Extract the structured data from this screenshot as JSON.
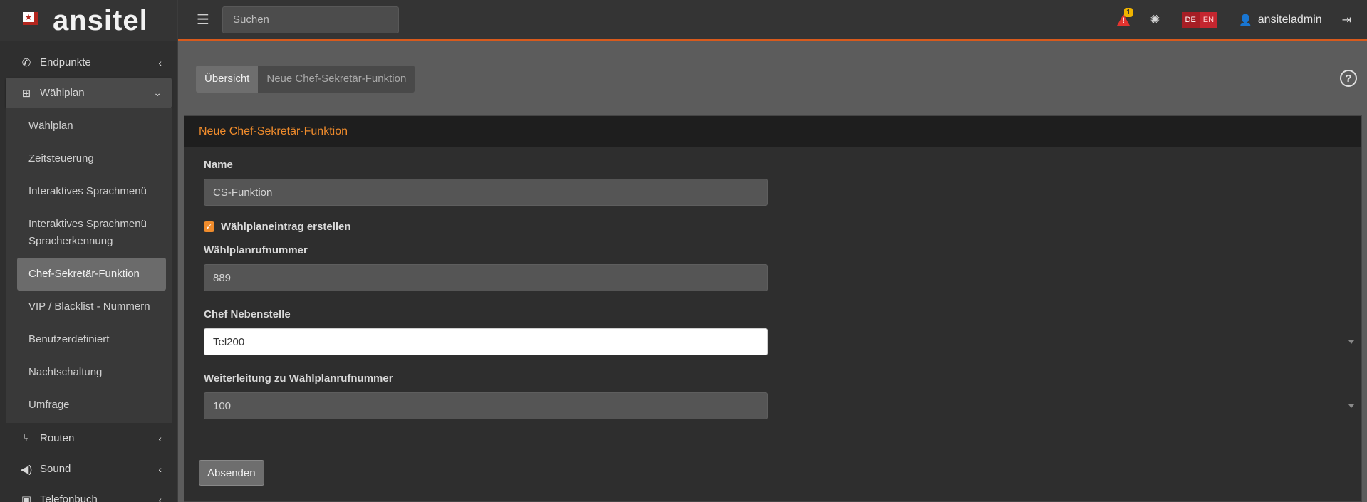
{
  "brand": {
    "name": "ansitel"
  },
  "sidebar": {
    "items": [
      {
        "label": "Endpunkte",
        "icon": "phone-icon"
      },
      {
        "label": "Wählplan",
        "icon": "sitemap-icon"
      },
      {
        "label": "Routen",
        "icon": "route-icon"
      },
      {
        "label": "Sound",
        "icon": "speaker-icon"
      },
      {
        "label": "Telefonbuch",
        "icon": "addressbook-icon"
      }
    ],
    "subitems": [
      "Wählplan",
      "Zeitsteuerung",
      "Interaktives Sprachmenü",
      "Interaktives Sprachmenü Spracherkennung",
      "Chef-Sekretär-Funktion",
      "VIP / Blacklist - Nummern",
      "Benutzerdefiniert",
      "Nachtschaltung",
      "Umfrage"
    ]
  },
  "topbar": {
    "search_placeholder": "Suchen",
    "alert_count": "1",
    "lang_de": "DE",
    "lang_en": "EN",
    "username": "ansiteladmin"
  },
  "breadcrumb": {
    "overview": "Übersicht",
    "current": "Neue Chef-Sekretär-Funktion"
  },
  "form": {
    "title": "Neue Chef-Sekretär-Funktion",
    "name_label": "Name",
    "name_value": "CS-Funktion",
    "checkbox_label": "Wählplaneintrag erstellen",
    "number_label": "Wählplanrufnummer",
    "number_value": "889",
    "chef_label": "Chef Nebenstelle",
    "chef_value": "Tel200",
    "forward_label": "Weiterleitung zu Wählplanrufnummer",
    "forward_value": "100",
    "submit_label": "Absenden"
  },
  "colors": {
    "accent": "#f08c2c",
    "topbar_border": "#d85a1c",
    "alert": "#e3342f"
  }
}
